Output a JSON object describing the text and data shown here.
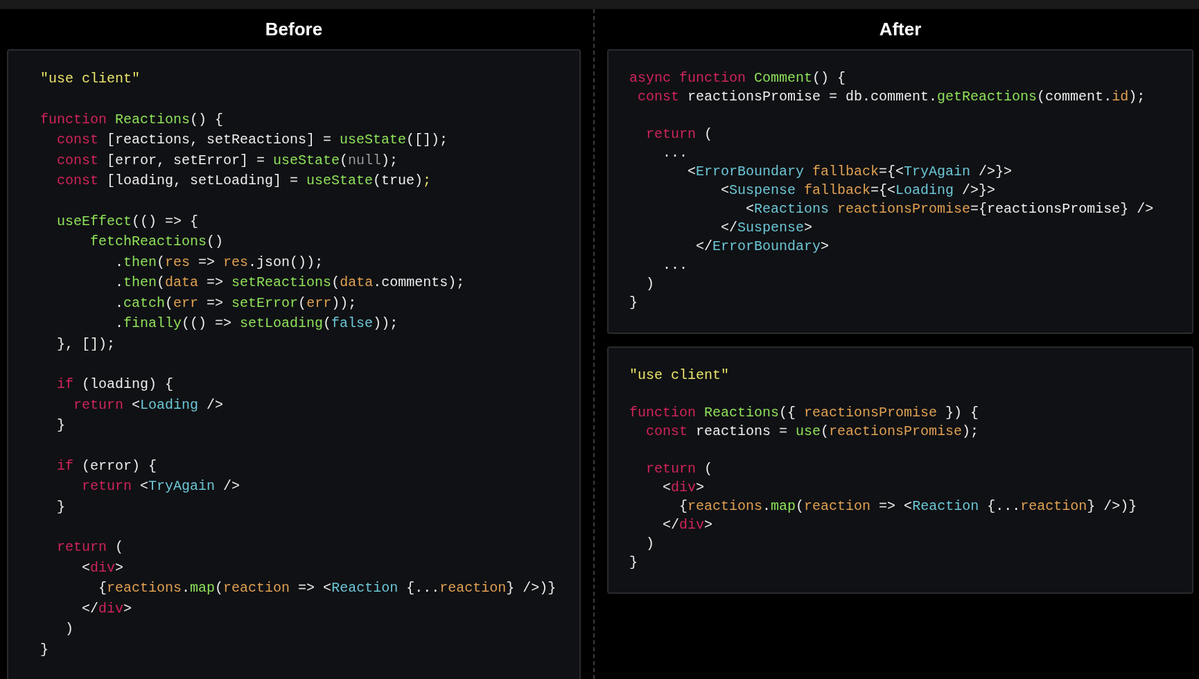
{
  "columns": [
    {
      "title": "Before",
      "panels": [
        {
          "blocks": [
            [
              [
                {
                  "kind": "str",
                  "text": "\"use client\""
                }
              ]
            ],
            [
              [
                {
                  "kind": "kw",
                  "text": "function "
                },
                {
                  "kind": "fn",
                  "text": "Reactions"
                },
                {
                  "kind": "plain",
                  "text": "() {"
                }
              ],
              [
                {
                  "kind": "kw",
                  "text": "  const "
                },
                {
                  "kind": "plain",
                  "text": "[reactions, setReactions] = "
                },
                {
                  "kind": "fn",
                  "text": "useState"
                },
                {
                  "kind": "plain",
                  "text": "([]);"
                }
              ],
              [
                {
                  "kind": "kw",
                  "text": "  const "
                },
                {
                  "kind": "plain",
                  "text": "[error, setError] = "
                },
                {
                  "kind": "fn",
                  "text": "useState"
                },
                {
                  "kind": "plain",
                  "text": "("
                },
                {
                  "kind": "muted",
                  "text": "null"
                },
                {
                  "kind": "plain",
                  "text": ");"
                }
              ],
              [
                {
                  "kind": "kw",
                  "text": "  const "
                },
                {
                  "kind": "plain",
                  "text": "[loading, setLoading] = "
                },
                {
                  "kind": "fn",
                  "text": "useState"
                },
                {
                  "kind": "plain",
                  "text": "(true)"
                },
                {
                  "kind": "str",
                  "text": ";"
                }
              ]
            ],
            [
              [
                {
                  "kind": "fn",
                  "text": "  useEffect"
                },
                {
                  "kind": "plain",
                  "text": "(() => {"
                }
              ],
              [
                {
                  "kind": "fn",
                  "text": "      fetchReactions"
                },
                {
                  "kind": "plain",
                  "text": "()"
                }
              ],
              [
                {
                  "kind": "plain",
                  "text": "         ."
                },
                {
                  "kind": "fn",
                  "text": "then"
                },
                {
                  "kind": "plain",
                  "text": "("
                },
                {
                  "kind": "param",
                  "text": "res"
                },
                {
                  "kind": "plain",
                  "text": " => "
                },
                {
                  "kind": "param",
                  "text": "res"
                },
                {
                  "kind": "plain",
                  "text": ".json());"
                }
              ],
              [
                {
                  "kind": "plain",
                  "text": "         ."
                },
                {
                  "kind": "fn",
                  "text": "then"
                },
                {
                  "kind": "plain",
                  "text": "("
                },
                {
                  "kind": "param",
                  "text": "data"
                },
                {
                  "kind": "plain",
                  "text": " => "
                },
                {
                  "kind": "fn",
                  "text": "setReactions"
                },
                {
                  "kind": "plain",
                  "text": "("
                },
                {
                  "kind": "param",
                  "text": "data"
                },
                {
                  "kind": "plain",
                  "text": ".comments);"
                }
              ],
              [
                {
                  "kind": "plain",
                  "text": "         ."
                },
                {
                  "kind": "fn",
                  "text": "catch"
                },
                {
                  "kind": "plain",
                  "text": "("
                },
                {
                  "kind": "param",
                  "text": "err"
                },
                {
                  "kind": "plain",
                  "text": " => "
                },
                {
                  "kind": "fn",
                  "text": "setError"
                },
                {
                  "kind": "plain",
                  "text": "("
                },
                {
                  "kind": "param",
                  "text": "err"
                },
                {
                  "kind": "plain",
                  "text": "));"
                }
              ],
              [
                {
                  "kind": "plain",
                  "text": "         ."
                },
                {
                  "kind": "fn",
                  "text": "finally"
                },
                {
                  "kind": "plain",
                  "text": "(() => "
                },
                {
                  "kind": "fn",
                  "text": "setLoading"
                },
                {
                  "kind": "plain",
                  "text": "("
                },
                {
                  "kind": "comp",
                  "text": "false"
                },
                {
                  "kind": "plain",
                  "text": "));"
                }
              ],
              [
                {
                  "kind": "plain",
                  "text": "  }, []);"
                }
              ]
            ],
            [
              [
                {
                  "kind": "kw",
                  "text": "  if"
                },
                {
                  "kind": "plain",
                  "text": " (loading) {"
                }
              ],
              [
                {
                  "kind": "kw",
                  "text": "    return"
                },
                {
                  "kind": "plain",
                  "text": " <"
                },
                {
                  "kind": "comp",
                  "text": "Loading"
                },
                {
                  "kind": "plain",
                  "text": " />"
                }
              ],
              [
                {
                  "kind": "plain",
                  "text": "  }"
                }
              ]
            ],
            [
              [
                {
                  "kind": "kw",
                  "text": "  if"
                },
                {
                  "kind": "plain",
                  "text": " (error) {"
                }
              ],
              [
                {
                  "kind": "kw",
                  "text": "     return"
                },
                {
                  "kind": "plain",
                  "text": " <"
                },
                {
                  "kind": "comp",
                  "text": "TryAgain"
                },
                {
                  "kind": "plain",
                  "text": " />"
                }
              ],
              [
                {
                  "kind": "plain",
                  "text": "  }"
                }
              ]
            ],
            [
              [
                {
                  "kind": "kw",
                  "text": "  return"
                },
                {
                  "kind": "plain",
                  "text": " ("
                }
              ],
              [
                {
                  "kind": "plain",
                  "text": "     <"
                },
                {
                  "kind": "kw",
                  "text": "div"
                },
                {
                  "kind": "plain",
                  "text": ">"
                }
              ],
              [
                {
                  "kind": "plain",
                  "text": "       {"
                },
                {
                  "kind": "param",
                  "text": "reactions"
                },
                {
                  "kind": "plain",
                  "text": "."
                },
                {
                  "kind": "fn",
                  "text": "map"
                },
                {
                  "kind": "plain",
                  "text": "("
                },
                {
                  "kind": "param",
                  "text": "reaction"
                },
                {
                  "kind": "plain",
                  "text": " => <"
                },
                {
                  "kind": "comp",
                  "text": "Reaction"
                },
                {
                  "kind": "plain",
                  "text": " {..."
                },
                {
                  "kind": "param",
                  "text": "reaction"
                },
                {
                  "kind": "plain",
                  "text": "} />)}"
                }
              ],
              [
                {
                  "kind": "plain",
                  "text": "     </"
                },
                {
                  "kind": "kw",
                  "text": "div"
                },
                {
                  "kind": "plain",
                  "text": ">"
                }
              ],
              [
                {
                  "kind": "plain",
                  "text": "   )"
                }
              ],
              [
                {
                  "kind": "plain",
                  "text": "}"
                }
              ]
            ]
          ]
        }
      ]
    },
    {
      "title": "After",
      "panels": [
        {
          "blocks": [
            [
              [
                {
                  "kind": "kw",
                  "text": "async function "
                },
                {
                  "kind": "fn",
                  "text": "Comment"
                },
                {
                  "kind": "plain",
                  "text": "() {"
                }
              ],
              [
                {
                  "kind": "kw",
                  "text": " const "
                },
                {
                  "kind": "plain",
                  "text": "reactionsPromise = db.comment."
                },
                {
                  "kind": "fn",
                  "text": "getReactions"
                },
                {
                  "kind": "plain",
                  "text": "(comment."
                },
                {
                  "kind": "param",
                  "text": "id"
                },
                {
                  "kind": "plain",
                  "text": ");"
                }
              ]
            ],
            [
              [
                {
                  "kind": "kw",
                  "text": "  return"
                },
                {
                  "kind": "plain",
                  "text": " ("
                }
              ],
              [
                {
                  "kind": "plain",
                  "text": "    ..."
                }
              ],
              [
                {
                  "kind": "plain",
                  "text": "       <"
                },
                {
                  "kind": "comp",
                  "text": "ErrorBoundary"
                },
                {
                  "kind": "param",
                  "text": " fallback"
                },
                {
                  "kind": "plain",
                  "text": "={<"
                },
                {
                  "kind": "comp",
                  "text": "TryAgain"
                },
                {
                  "kind": "plain",
                  "text": " />}>"
                }
              ],
              [
                {
                  "kind": "plain",
                  "text": "           <"
                },
                {
                  "kind": "comp",
                  "text": "Suspense"
                },
                {
                  "kind": "param",
                  "text": " fallback"
                },
                {
                  "kind": "plain",
                  "text": "={<"
                },
                {
                  "kind": "comp",
                  "text": "Loading"
                },
                {
                  "kind": "plain",
                  "text": " />}>"
                }
              ],
              [
                {
                  "kind": "plain",
                  "text": "              <"
                },
                {
                  "kind": "comp",
                  "text": "Reactions"
                },
                {
                  "kind": "param",
                  "text": " reactionsPromise"
                },
                {
                  "kind": "plain",
                  "text": "={reactionsPromise} />"
                }
              ],
              [
                {
                  "kind": "plain",
                  "text": "           </"
                },
                {
                  "kind": "comp",
                  "text": "Suspense"
                },
                {
                  "kind": "plain",
                  "text": ">"
                }
              ],
              [
                {
                  "kind": "plain",
                  "text": "        </"
                },
                {
                  "kind": "comp",
                  "text": "ErrorBoundary"
                },
                {
                  "kind": "plain",
                  "text": ">"
                }
              ],
              [
                {
                  "kind": "plain",
                  "text": "    ..."
                }
              ],
              [
                {
                  "kind": "plain",
                  "text": "  )"
                }
              ],
              [
                {
                  "kind": "plain",
                  "text": "}"
                }
              ]
            ]
          ]
        },
        {
          "blocks": [
            [
              [
                {
                  "kind": "str",
                  "text": "\"use client\""
                }
              ]
            ],
            [
              [
                {
                  "kind": "kw",
                  "text": "function "
                },
                {
                  "kind": "fn",
                  "text": "Reactions"
                },
                {
                  "kind": "plain",
                  "text": "({ "
                },
                {
                  "kind": "param",
                  "text": "reactionsPromise"
                },
                {
                  "kind": "plain",
                  "text": " }) {"
                }
              ],
              [
                {
                  "kind": "kw",
                  "text": "  const "
                },
                {
                  "kind": "plain",
                  "text": "reactions = "
                },
                {
                  "kind": "fn",
                  "text": "use"
                },
                {
                  "kind": "plain",
                  "text": "("
                },
                {
                  "kind": "param",
                  "text": "reactionsPromise"
                },
                {
                  "kind": "plain",
                  "text": ");"
                }
              ]
            ],
            [
              [
                {
                  "kind": "kw",
                  "text": "  return"
                },
                {
                  "kind": "plain",
                  "text": " ("
                }
              ],
              [
                {
                  "kind": "plain",
                  "text": "    <"
                },
                {
                  "kind": "kw",
                  "text": "div"
                },
                {
                  "kind": "plain",
                  "text": ">"
                }
              ],
              [
                {
                  "kind": "plain",
                  "text": "      {"
                },
                {
                  "kind": "param",
                  "text": "reactions"
                },
                {
                  "kind": "plain",
                  "text": "."
                },
                {
                  "kind": "fn",
                  "text": "map"
                },
                {
                  "kind": "plain",
                  "text": "("
                },
                {
                  "kind": "param",
                  "text": "reaction"
                },
                {
                  "kind": "plain",
                  "text": " => <"
                },
                {
                  "kind": "comp",
                  "text": "Reaction"
                },
                {
                  "kind": "plain",
                  "text": " {..."
                },
                {
                  "kind": "param",
                  "text": "reaction"
                },
                {
                  "kind": "plain",
                  "text": "} />)}"
                }
              ],
              [
                {
                  "kind": "plain",
                  "text": "    </"
                },
                {
                  "kind": "kw",
                  "text": "div"
                },
                {
                  "kind": "plain",
                  "text": ">"
                }
              ],
              [
                {
                  "kind": "plain",
                  "text": "  )"
                }
              ],
              [
                {
                  "kind": "plain",
                  "text": "}"
                }
              ]
            ]
          ]
        }
      ]
    }
  ]
}
